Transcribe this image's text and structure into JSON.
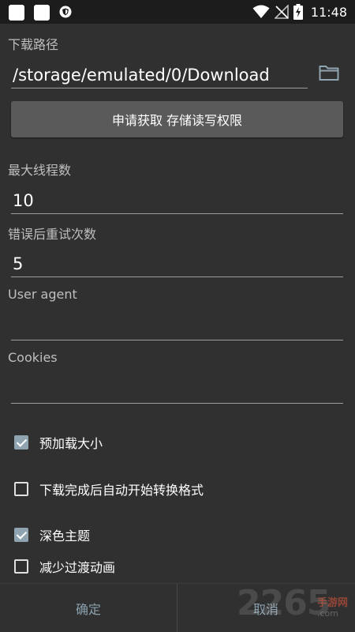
{
  "status_bar": {
    "time": "11:48",
    "icons": [
      "app-notification-icon",
      "app-notification-icon",
      "shield-icon",
      "wifi-icon",
      "no-signal-icon",
      "battery-charging-icon"
    ]
  },
  "form": {
    "download_path_label": "下载路径",
    "download_path_value": "/storage/emulated/0/Download",
    "permission_button": "申请获取 存储读写权限",
    "max_threads_label": "最大线程数",
    "max_threads_value": "10",
    "retry_label": "错误后重试次数",
    "retry_value": "5",
    "user_agent_label": "User agent",
    "user_agent_value": "",
    "cookies_label": "Cookies",
    "cookies_value": ""
  },
  "options": [
    {
      "label": "预加载大小",
      "checked": true
    },
    {
      "label": "下载完成后自动开始转换格式",
      "checked": false
    },
    {
      "label": "深色主题",
      "checked": true
    },
    {
      "label": "减少过渡动画",
      "checked": false
    }
  ],
  "dialog": {
    "confirm": "确定",
    "cancel": "取消"
  },
  "watermark": {
    "number": "2265",
    "cn": "手游网",
    "domain": ".com"
  },
  "colors": {
    "background": "#303030",
    "accent": "#8fa4b0",
    "button": "#5a5a5a"
  }
}
